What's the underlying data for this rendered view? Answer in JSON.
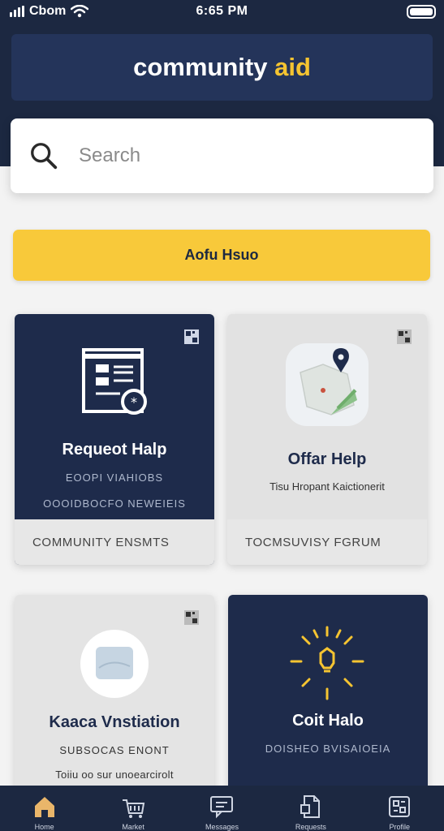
{
  "status": {
    "carrier": "Cbom",
    "time": "6:65 PM"
  },
  "header": {
    "title_main": "community",
    "title_accent": "aid"
  },
  "search": {
    "placeholder": "Search"
  },
  "cta": {
    "label": "Aofu Hsuo"
  },
  "cards": [
    {
      "title": "Requeot Halp",
      "line1": "EOOPI VIAHIOBS",
      "line2": "OOOIDBOCFO NEWEIEIS",
      "footer": "COMMUNITY ENSMTS",
      "icon": "form-list-icon"
    },
    {
      "title": "Offar Help",
      "line1": "Tisu Hropant Kaictionerit",
      "footer": "TOCMSUVISY FGRUM",
      "icon": "map-pin-icon"
    },
    {
      "title": "Kaaca Vnstiation",
      "line1": "SUBSOCAS ENONT",
      "line2": "Toiiu oo sur unoearcirolt",
      "icon": "globe-circle-icon"
    },
    {
      "title": "Coit Halo",
      "line1": "DOISHEO BVISAIOEIA",
      "icon": "lightbulb-rays-icon"
    }
  ],
  "nav": [
    {
      "label": "Home",
      "icon": "home-icon"
    },
    {
      "label": "Market",
      "icon": "basket-icon"
    },
    {
      "label": "Messages",
      "icon": "chat-icon"
    },
    {
      "label": "Requests",
      "icon": "document-icon"
    },
    {
      "label": "Profile",
      "icon": "settings-icon"
    }
  ],
  "colors": {
    "navy": "#1c2841",
    "card_navy": "#1e2b4b",
    "accent": "#f5c431",
    "button": "#f8c93a"
  }
}
